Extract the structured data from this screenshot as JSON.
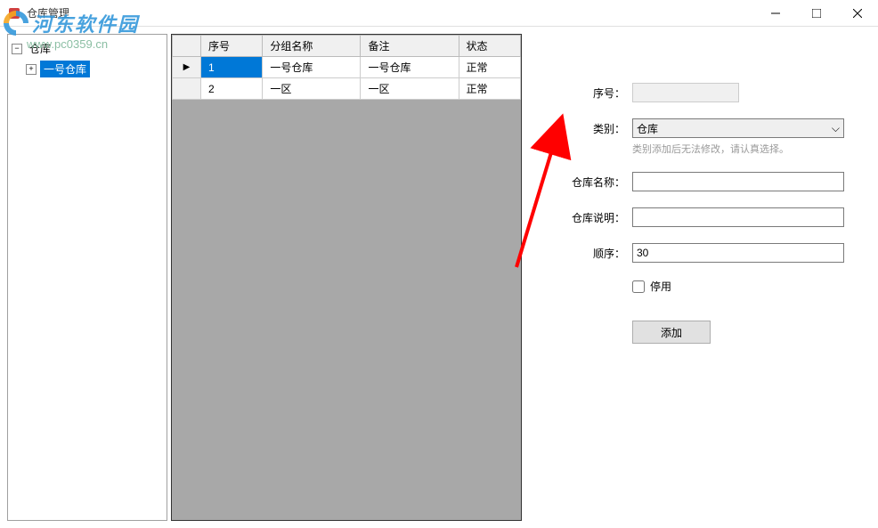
{
  "titlebar": {
    "title": "仓库管理"
  },
  "watermark": {
    "text": "河东软件园",
    "url": "www.pc0359.cn"
  },
  "tree": {
    "root": "仓库",
    "children": [
      {
        "label": "一号仓库"
      }
    ]
  },
  "table": {
    "headers": [
      "序号",
      "分组名称",
      "备注",
      "状态"
    ],
    "rows": [
      {
        "indicator": "▶",
        "selected": true,
        "cells": [
          "1",
          "一号仓库",
          "一号仓库",
          "正常"
        ]
      },
      {
        "indicator": "",
        "selected": false,
        "cells": [
          "2",
          "一区",
          "一区",
          "正常"
        ]
      }
    ]
  },
  "form": {
    "labels": {
      "serial": "序号：",
      "category": "类别：",
      "name": "仓库名称：",
      "desc": "仓库说明：",
      "order": "顺序：",
      "disabled": "停用"
    },
    "values": {
      "serial": "",
      "category": "仓库",
      "category_hint": "类别添加后无法修改，请认真选择。",
      "name": "",
      "desc": "",
      "order": "30"
    },
    "button": "添加"
  }
}
